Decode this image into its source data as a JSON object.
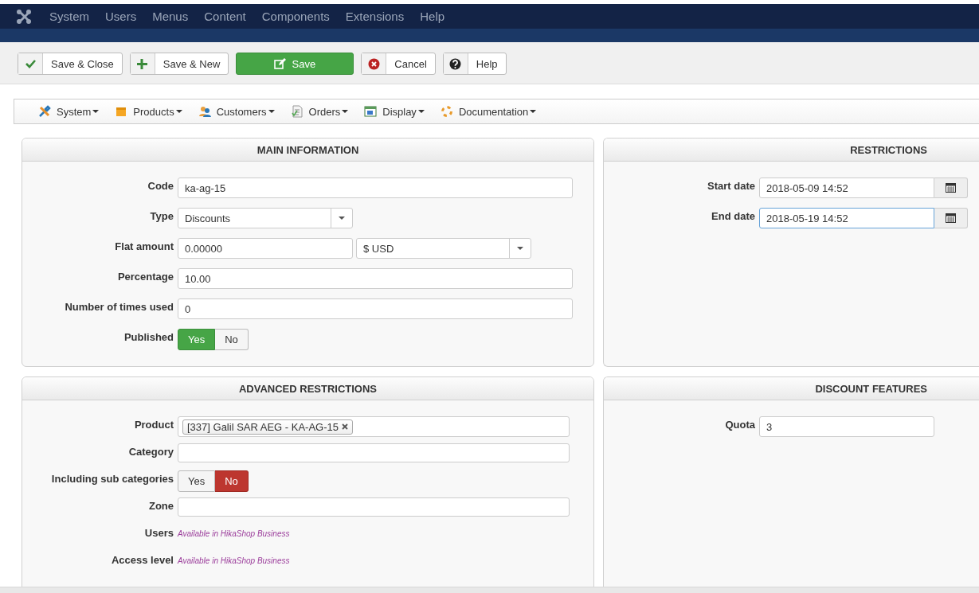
{
  "top_menu": {
    "items": [
      "System",
      "Users",
      "Menus",
      "Content",
      "Components",
      "Extensions",
      "Help"
    ]
  },
  "toolbar": {
    "buttons": [
      {
        "label": "Save & Close",
        "kind": "check"
      },
      {
        "label": "Save & New",
        "kind": "plus"
      },
      {
        "label": "Save",
        "kind": "primary"
      },
      {
        "label": "Cancel",
        "kind": "cancel"
      },
      {
        "label": "Help",
        "kind": "help"
      }
    ]
  },
  "submenu": {
    "items": [
      {
        "label": "System",
        "kind": "tools"
      },
      {
        "label": "Products",
        "kind": "box"
      },
      {
        "label": "Customers",
        "kind": "people"
      },
      {
        "label": "Orders",
        "kind": "document"
      },
      {
        "label": "Display",
        "kind": "display"
      },
      {
        "label": "Documentation",
        "kind": "lifebuoy"
      }
    ]
  },
  "panels": [
    {
      "title": "MAIN INFORMATION",
      "fields": [
        {
          "label": "Code",
          "kind": "text",
          "value": "ka-ag-15"
        },
        {
          "label": "Type",
          "kind": "select",
          "value": "Discounts"
        },
        {
          "label": "Flat amount",
          "kind": "amount",
          "value": "0.00000",
          "currency": "$ USD"
        },
        {
          "label": "Percentage",
          "kind": "text",
          "value": "10.00"
        },
        {
          "label": "Number of times used",
          "kind": "text",
          "value": "0"
        },
        {
          "label": "Published",
          "kind": "toggle",
          "options": [
            {
              "label": "Yes",
              "kind": "yes",
              "selected": true
            },
            {
              "label": "No",
              "kind": "no",
              "selected": false
            }
          ]
        }
      ]
    },
    {
      "title": "RESTRICTIONS",
      "fields": [
        {
          "label": "Start date",
          "kind": "date",
          "value": "2018-05-09 14:52",
          "focused": false
        },
        {
          "label": "End date",
          "kind": "date",
          "value": "2018-05-19 14:52",
          "focused": true
        }
      ]
    },
    {
      "title": "ADVANCED RESTRICTIONS",
      "fields": [
        {
          "label": "Product",
          "kind": "tags",
          "tags": [
            "[337] Galil SAR AEG - KA-AG-15"
          ]
        },
        {
          "label": "Category",
          "kind": "text"
        },
        {
          "label": "Including sub categories",
          "kind": "toggle",
          "options": [
            {
              "label": "Yes",
              "kind": "yes",
              "selected": false
            },
            {
              "label": "No",
              "kind": "no",
              "selected": true
            }
          ]
        },
        {
          "label": "Zone",
          "kind": "text"
        },
        {
          "label": "Users",
          "kind": "note",
          "note": "Available in HikaShop Business"
        },
        {
          "label": "Access level",
          "kind": "note",
          "note": "Available in HikaShop Business"
        }
      ]
    },
    {
      "title": "DISCOUNT FEATURES",
      "fields": [
        {
          "label": "Quota",
          "kind": "short",
          "value": "3"
        }
      ]
    }
  ]
}
